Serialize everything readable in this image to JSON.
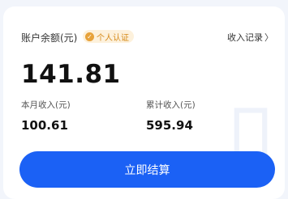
{
  "balance": {
    "label": "账户余额(元)",
    "verify_badge": "个人认证",
    "amount": "141.81"
  },
  "record_link": {
    "label": "收入记录",
    "icon": "chevron-right-icon"
  },
  "stats": [
    {
      "label": "本月收入(元)",
      "value": "100.61"
    },
    {
      "label": "累计收入(元)",
      "value": "595.94"
    }
  ],
  "settle_button": {
    "label": "立即结算"
  },
  "colors": {
    "accent": "#1b61f5",
    "badge_bg": "#fdf1dc",
    "badge_text": "#d68a1a"
  }
}
